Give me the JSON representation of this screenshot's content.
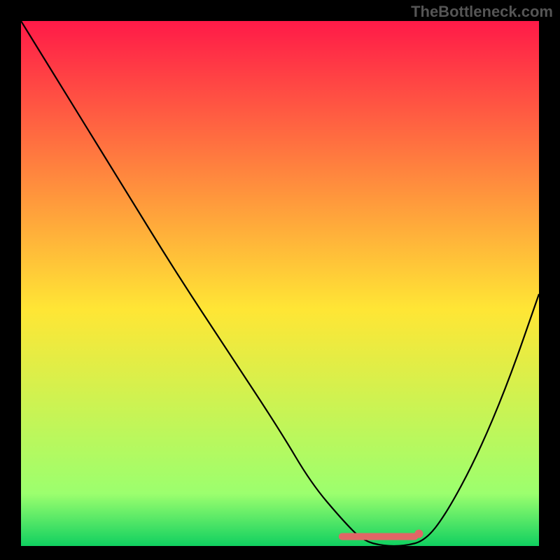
{
  "watermark": "TheBottleneck.com",
  "chart_data": {
    "type": "line",
    "title": "",
    "xlabel": "",
    "ylabel": "",
    "xlim": [
      0,
      100
    ],
    "ylim": [
      0,
      100
    ],
    "grid": false,
    "legend": false,
    "series": [
      {
        "name": "curve",
        "color": "#000000",
        "x": [
          0,
          10,
          20,
          30,
          40,
          50,
          56,
          62,
          66,
          70,
          74,
          78,
          82,
          88,
          94,
          100
        ],
        "y": [
          100,
          84,
          68,
          52,
          37,
          22,
          12,
          5,
          1,
          0,
          0,
          1,
          6,
          17,
          31,
          48
        ]
      }
    ],
    "flat_segment": {
      "x_range": [
        62,
        76
      ],
      "y": 1,
      "color": "#e06666"
    },
    "background_gradient": [
      "#ff1a48",
      "#ffe635",
      "#9cff6e",
      "#10d060"
    ]
  }
}
